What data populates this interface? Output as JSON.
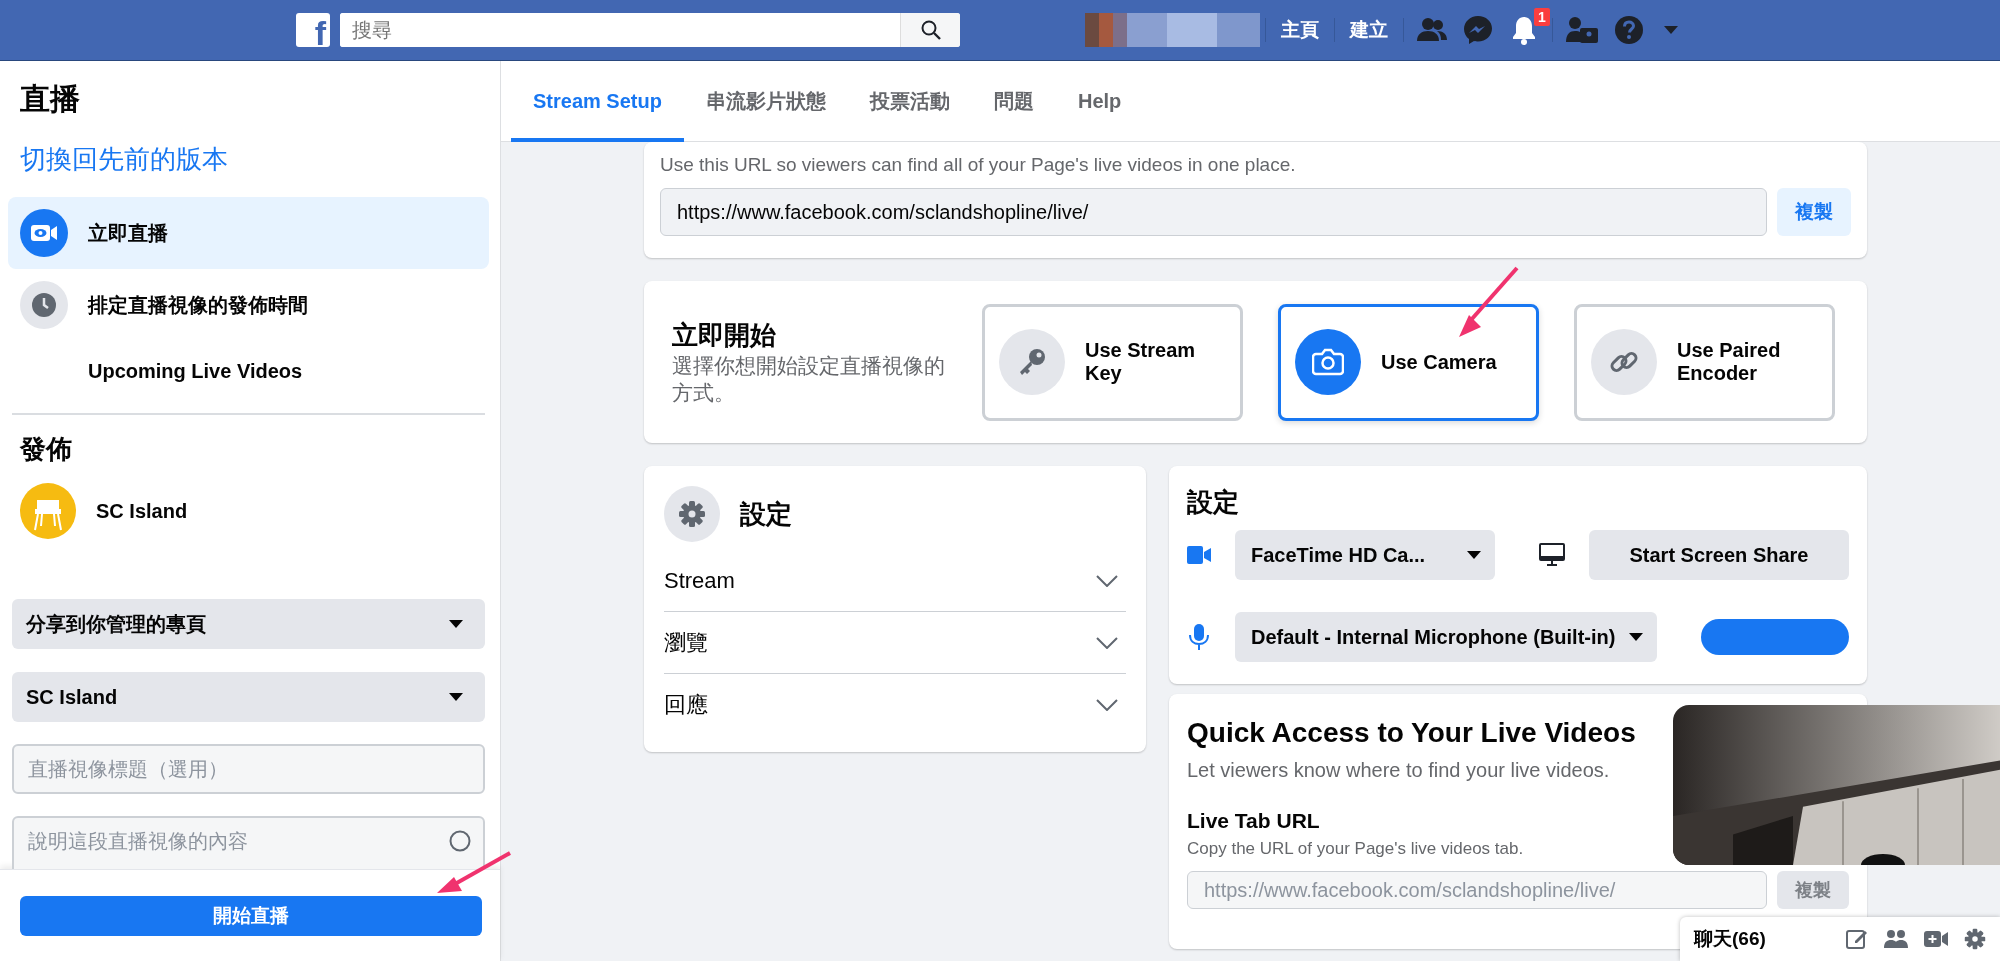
{
  "top_bar": {
    "logo": "f",
    "search": {
      "placeholder": "搜尋"
    },
    "nav_links": [
      "主頁",
      "建立"
    ],
    "notification_badge": "1"
  },
  "sidebar": {
    "title": "直播",
    "switch_link": "切換回先前的版本",
    "items": [
      {
        "label": "立即直播",
        "selected": true,
        "kind": "video"
      },
      {
        "label": "排定直播視像的發佈時間",
        "selected": false,
        "kind": "clock"
      },
      {
        "label": "Upcoming Live Videos",
        "selected": false,
        "kind": "plain"
      }
    ],
    "publish_heading": "發佈",
    "page_name": "SC Island",
    "share_dropdown": "分享到你管理的專頁",
    "page_dropdown": "SC Island",
    "title_field": {
      "placeholder": "直播視像標題（選用）"
    },
    "description_field": {
      "placeholder": "說明這段直播視像的內容"
    },
    "go_live_button": "開始直播"
  },
  "tabs": [
    {
      "label": "Stream Setup",
      "selected": true
    },
    {
      "label": "串流影片狀態",
      "selected": false
    },
    {
      "label": "投票活動",
      "selected": false
    },
    {
      "label": "問題",
      "selected": false
    },
    {
      "label": "Help",
      "selected": false
    }
  ],
  "url_card": {
    "description": "Use this URL so viewers can find all of your Page's live videos in one place.",
    "url": "https://www.facebook.com/sclandshopline/live/",
    "copy_button": "複製"
  },
  "start_card": {
    "title": "立即開始",
    "subtitle": "選擇你想開始設定直播視像的方式。",
    "options": [
      {
        "label": "Use Stream Key",
        "selected": false,
        "kind": "key"
      },
      {
        "label": "Use Camera",
        "selected": true,
        "kind": "camera"
      },
      {
        "label": "Use Paired Encoder",
        "selected": false,
        "kind": "link"
      }
    ]
  },
  "settings_panel": {
    "title": "設定",
    "sections": [
      {
        "label": "Stream",
        "expanded": false
      },
      {
        "label": "瀏覽",
        "expanded": false
      },
      {
        "label": "回應",
        "expanded": false
      }
    ]
  },
  "device_card": {
    "title": "設定",
    "camera_select": "FaceTime HD Ca...",
    "screen_share_button": "Start Screen Share",
    "microphone_select": "Default - Internal Microphone (Built-in)"
  },
  "quick_access": {
    "title": "Quick Access to Your Live Videos",
    "subtitle": "Let viewers know where to find your live videos.",
    "live_tab_label": "Live Tab URL",
    "live_tab_hint": "Copy the URL of your Page's live videos tab.",
    "url": "https://www.facebook.com/sclandshopline/live/",
    "copy_button": {
      "label": "複製",
      "disabled": true
    }
  },
  "chat_bar": {
    "label": "聊天(66)"
  }
}
